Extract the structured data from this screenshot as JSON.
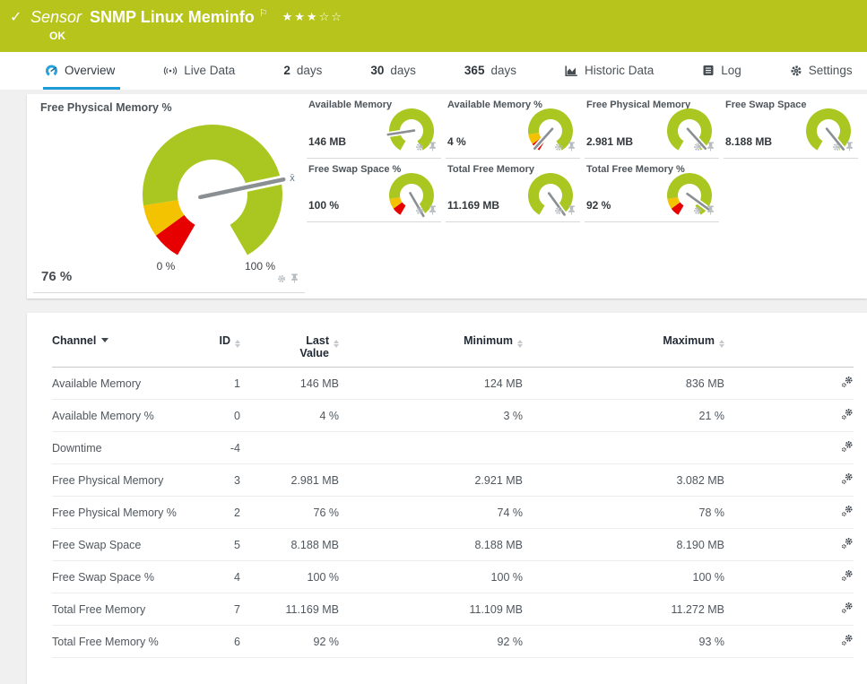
{
  "header": {
    "status_icon": "check",
    "sensor_label": "Sensor",
    "title": "SNMP Linux Meminfo",
    "status": "OK",
    "rating": {
      "filled": 3,
      "total": 5
    }
  },
  "tabs": [
    {
      "label": "Overview",
      "icon": "gauge-icon",
      "active": true
    },
    {
      "label": "Live Data",
      "icon": "broadcast-icon",
      "active": false
    },
    {
      "num": "2",
      "label": "days",
      "active": false
    },
    {
      "num": "30",
      "label": "days",
      "active": false
    },
    {
      "num": "365",
      "label": "days",
      "active": false
    },
    {
      "label": "Historic Data",
      "icon": "chart-icon",
      "active": false
    },
    {
      "label": "Log",
      "icon": "log-icon",
      "active": false
    },
    {
      "label": "Settings",
      "icon": "gear-icon",
      "active": false
    }
  ],
  "gauges": {
    "primary": {
      "title": "Free Physical Memory %",
      "value": "76 %",
      "scale_min": "0 %",
      "scale_max": "100 %",
      "needle_pct": 76,
      "kind": "percent",
      "avg_marker": "x̄"
    },
    "small": [
      {
        "title": "Available Memory",
        "value": "146 MB",
        "needle_pct": 17,
        "kind": "plain"
      },
      {
        "title": "Available Memory %",
        "value": "4 %",
        "needle_pct": 4,
        "kind": "percent"
      },
      {
        "title": "Free Physical Memory",
        "value": "2.981 MB",
        "needle_pct": 96,
        "kind": "plain"
      },
      {
        "title": "Free Swap Space",
        "value": "8.188 MB",
        "needle_pct": 97,
        "kind": "plain"
      },
      {
        "title": "Free Swap Space %",
        "value": "100 %",
        "needle_pct": 100,
        "kind": "percent"
      },
      {
        "title": "Total Free Memory",
        "value": "11.169 MB",
        "needle_pct": 98,
        "kind": "plain"
      },
      {
        "title": "Total Free Memory %",
        "value": "92 %",
        "needle_pct": 92,
        "kind": "percent"
      }
    ],
    "segments": {
      "percent": [
        {
          "from": 0,
          "to": 8,
          "color": "#e60000"
        },
        {
          "from": 8,
          "to": 17,
          "color": "#f3c200"
        },
        {
          "from": 17,
          "to": 100,
          "color": "#a9c720"
        }
      ],
      "plain": [
        {
          "from": 0,
          "to": 100,
          "color": "#a9c720"
        }
      ]
    }
  },
  "table": {
    "columns": [
      {
        "key": "channel",
        "label": "Channel",
        "sort": "active"
      },
      {
        "key": "id",
        "label": "ID",
        "sort": "both"
      },
      {
        "key": "last",
        "label": "Last Value",
        "sort": "both",
        "two_line": true
      },
      {
        "key": "min",
        "label": "Minimum",
        "sort": "both"
      },
      {
        "key": "max",
        "label": "Maximum",
        "sort": "both"
      },
      {
        "key": "settings",
        "label": "",
        "sort": "none"
      }
    ],
    "rows": [
      {
        "channel": "Available Memory",
        "id": "1",
        "last": "146 MB",
        "min": "124 MB",
        "max": "836 MB"
      },
      {
        "channel": "Available Memory %",
        "id": "0",
        "last": "4 %",
        "min": "3 %",
        "max": "21 %"
      },
      {
        "channel": "Downtime",
        "id": "-4",
        "last": "",
        "min": "",
        "max": ""
      },
      {
        "channel": "Free Physical Memory",
        "id": "3",
        "last": "2.981 MB",
        "min": "2.921 MB",
        "max": "3.082 MB"
      },
      {
        "channel": "Free Physical Memory %",
        "id": "2",
        "last": "76 %",
        "min": "74 %",
        "max": "78 %"
      },
      {
        "channel": "Free Swap Space",
        "id": "5",
        "last": "8.188 MB",
        "min": "8.188 MB",
        "max": "8.190 MB"
      },
      {
        "channel": "Free Swap Space %",
        "id": "4",
        "last": "100 %",
        "min": "100 %",
        "max": "100 %"
      },
      {
        "channel": "Total Free Memory",
        "id": "7",
        "last": "11.169 MB",
        "min": "11.109 MB",
        "max": "11.272 MB"
      },
      {
        "channel": "Total Free Memory %",
        "id": "6",
        "last": "92 %",
        "min": "92 %",
        "max": "93 %"
      }
    ]
  },
  "colors": {
    "status_ok": "#b6c41c",
    "accent_blue": "#1e9bd7",
    "gauge_green": "#a9c720",
    "gauge_yellow": "#f3c200",
    "gauge_red": "#e60000",
    "needle_gray": "#8a8f93"
  }
}
